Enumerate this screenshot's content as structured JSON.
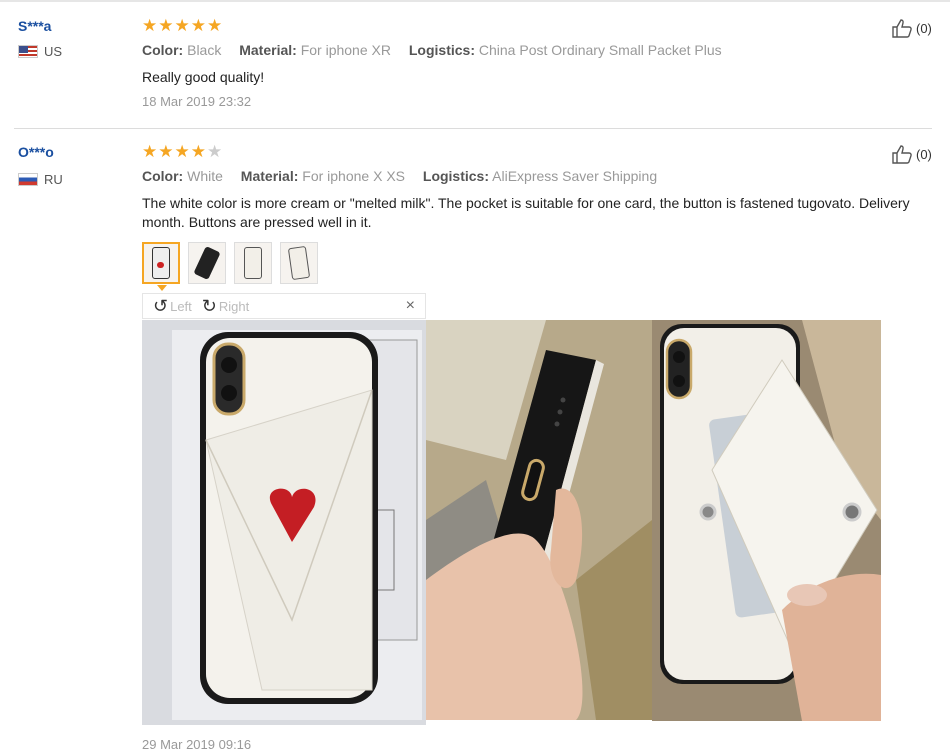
{
  "reviews": [
    {
      "user": "S***a",
      "country": "US",
      "rating": 5,
      "color_label": "Color:",
      "color": "Black",
      "material_label": "Material:",
      "material": "For iphone XR",
      "logistics_label": "Logistics:",
      "logistics": "China Post Ordinary Small Packet Plus",
      "text": "Really good quality!",
      "date": "18 Mar 2019 23:32",
      "likes": "(0)"
    },
    {
      "user": "O***o",
      "country": "RU",
      "rating": 4,
      "color_label": "Color:",
      "color": "White",
      "material_label": "Material:",
      "material": "For iphone X XS",
      "logistics_label": "Logistics:",
      "logistics": "AliExpress Saver Shipping",
      "text": "The white color is more cream or \"melted milk\". The pocket is suitable for one card, the button is fastened tugovato. Delivery month. Buttons are pressed well in it.",
      "date": "29 Mar 2019 09:16",
      "likes": "(0)"
    }
  ],
  "viewer": {
    "rotate_left": "Left",
    "rotate_right": "Right",
    "close": "×",
    "photos": [
      "phone-case-package-photo",
      "phone-case-side-in-hand-photo",
      "phone-case-card-pocket-photo"
    ]
  },
  "colors": {
    "star": "#f5a623",
    "username": "#1a4fa0",
    "muted": "#999999"
  },
  "icons": {
    "star": "★",
    "thumb_up": "thumbs-up-icon",
    "rotate_left": "↺",
    "rotate_right": "↻"
  }
}
